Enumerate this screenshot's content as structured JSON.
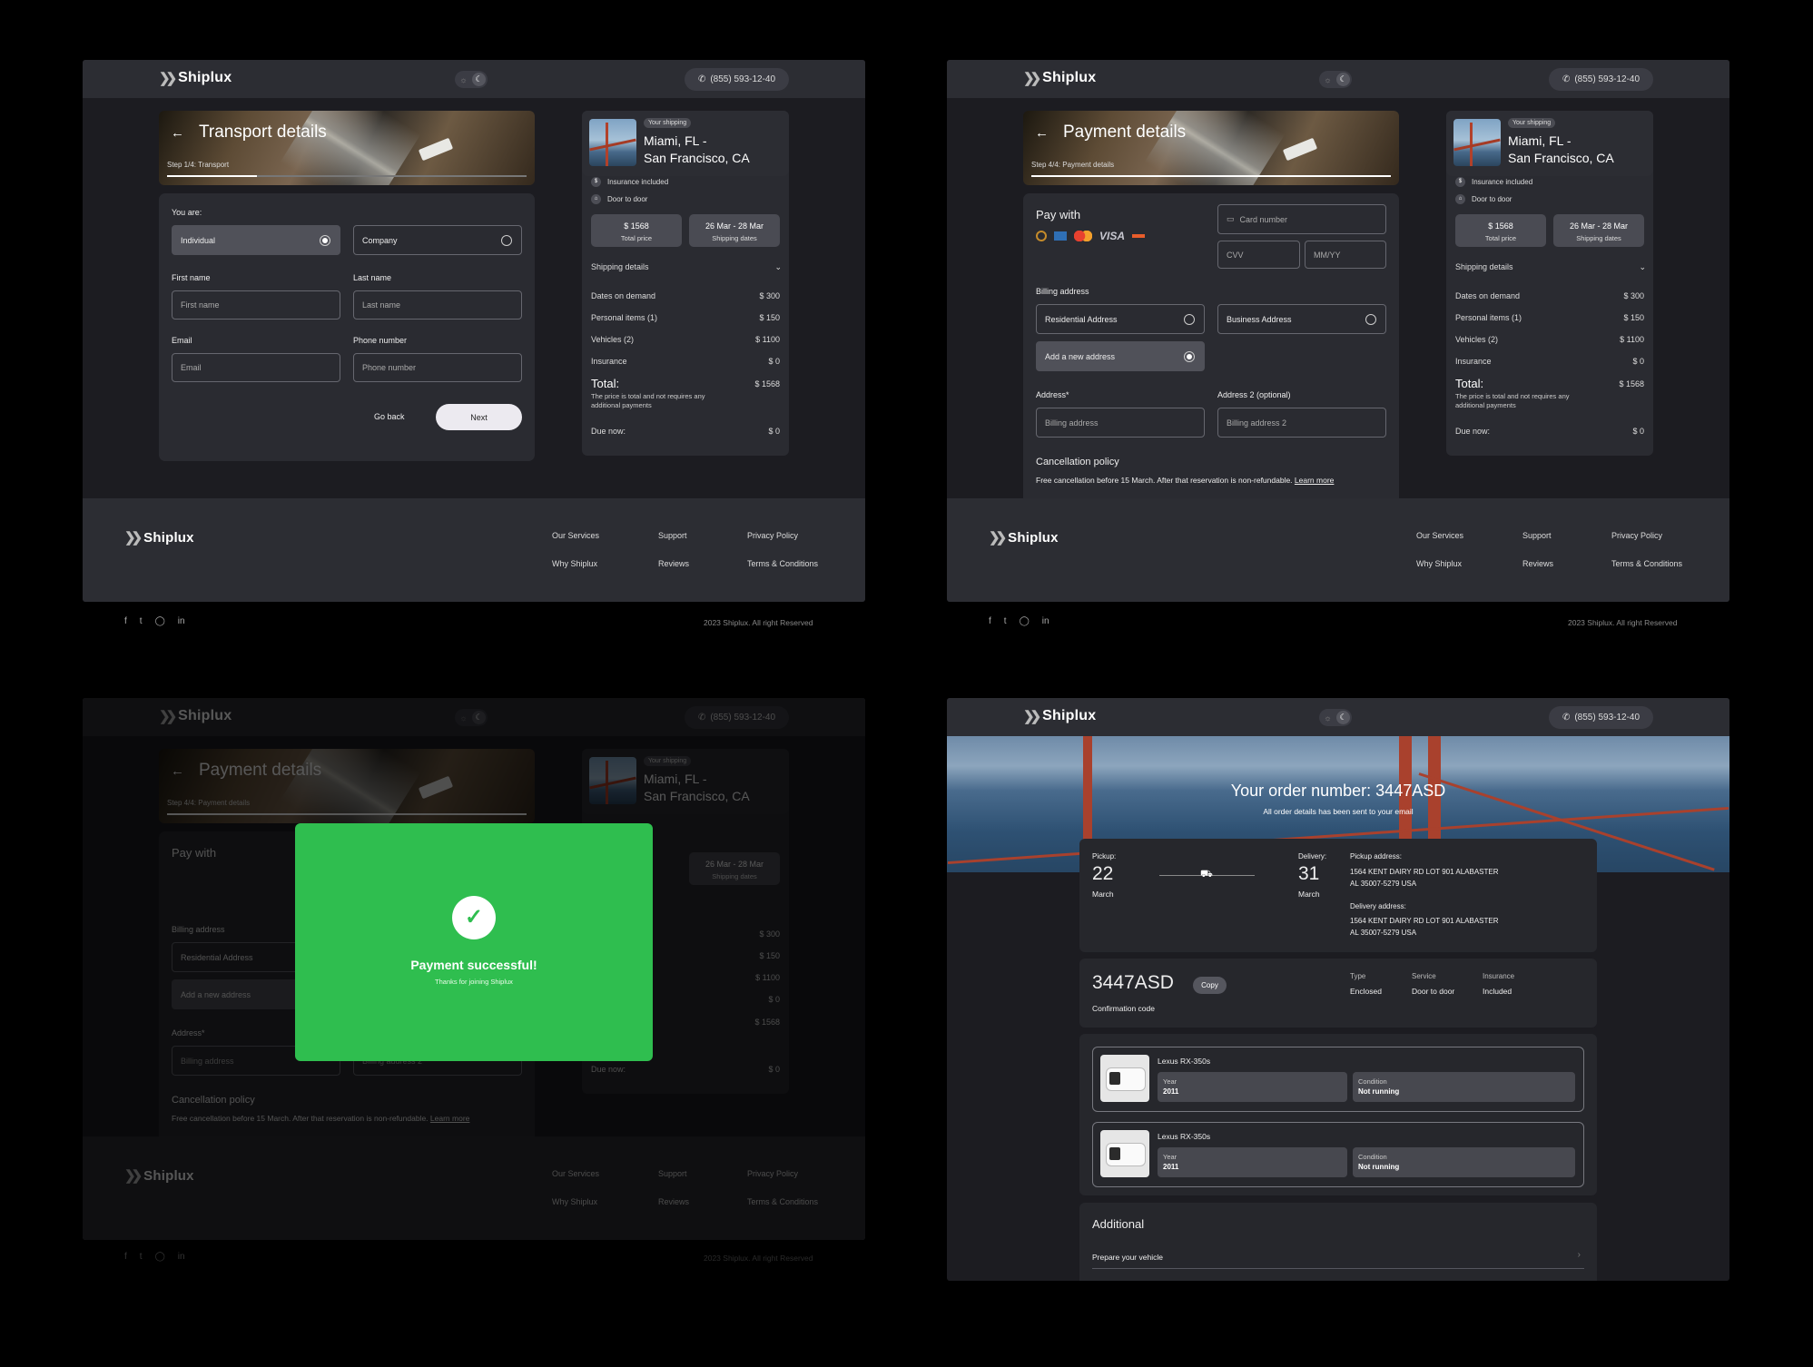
{
  "brand": "Shiplux",
  "phone": "(855) 593-12-40",
  "theme_toggle": {
    "light_icon": "sun-icon",
    "dark_icon": "moon-icon"
  },
  "transport": {
    "title": "Transport details",
    "step": "Step 1/4: Transport",
    "progress_fraction": 0.25,
    "you_are": "You are:",
    "individual": "Individual",
    "company": "Company",
    "first_name_label": "First name",
    "first_name_placeholder": "First name",
    "last_name_label": "Last name",
    "last_name_placeholder": "Last name",
    "email_label": "Email",
    "email_placeholder": "Email",
    "phone_label": "Phone number",
    "phone_placeholder": "Phone number",
    "go_back": "Go back",
    "next": "Next"
  },
  "payment": {
    "title": "Payment details",
    "step": "Step 4/4: Payment details",
    "progress_fraction": 1.0,
    "pay_with": "Pay with",
    "card_brands": [
      "bitcoin-icon",
      "amex-icon",
      "mastercard-icon",
      "VISA",
      "maestro-icon"
    ],
    "visa": "VISA",
    "card_number": "Card number",
    "cvv": "CVV",
    "expiry": "MM/YY",
    "billing_address": "Billing address",
    "residential": "Residential Address",
    "business": "Business Address",
    "add_new": "Add a new address",
    "address_label": "Address*",
    "address_placeholder": "Billing address",
    "address2_label": "Address 2 (optional)",
    "address2_placeholder": "Billing address 2",
    "cancel_title": "Cancellation policy",
    "cancel_text": "Free cancellation before 15 March. After that reservation is non-refundable.",
    "learn_more": "Learn more"
  },
  "summary": {
    "tag": "Your shipping",
    "route_line1": "Miami, FL -",
    "route_line2": "San Francisco, CA",
    "insurance_included": "Insurance included",
    "door_to_door": "Door to door",
    "total_price": "$ 1568",
    "total_price_label": "Total price",
    "dates": "26 Mar - 28 Mar",
    "dates_label": "Shipping dates",
    "shipping_details": "Shipping details",
    "rows": [
      {
        "label": "Dates on demand",
        "value": "$ 300"
      },
      {
        "label": "Personal items (1)",
        "value": "$ 150"
      },
      {
        "label": "Vehicles (2)",
        "value": "$ 1100"
      },
      {
        "label": "Insurance",
        "value": "$ 0"
      }
    ],
    "total_label": "Total:",
    "total_value": "$ 1568",
    "total_note": "The price is total and not requires any additional payments",
    "due_label": "Due now:",
    "due_value": "$ 0"
  },
  "footer": {
    "links": [
      "Our Services",
      "Support",
      "Privacy Policy",
      "Why Shiplux",
      "Reviews",
      "Terms & Conditions"
    ],
    "social": [
      "facebook-icon",
      "twitter-icon",
      "instagram-icon",
      "linkedin-icon"
    ],
    "copyright": "2023 Shiplux. All right Reserved"
  },
  "modal": {
    "title": "Payment successful!",
    "subtitle": "Thanks for joining Shiplux"
  },
  "order": {
    "heading": "Your order number: 3447ASD",
    "sub": "All order details has been sent to your email",
    "pickup_label": "Pickup:",
    "pickup_day": "22",
    "pickup_month": "March",
    "delivery_label": "Delivery:",
    "delivery_day": "31",
    "delivery_month": "March",
    "pickup_address_label": "Pickup address:",
    "pickup_address_1": "1564 KENT DAIRY RD LOT 901 ALABASTER",
    "pickup_address_2": "AL 35007-5279 USA",
    "delivery_address_label": "Delivery address:",
    "delivery_address_1": "1564 KENT DAIRY RD LOT 901 ALABASTER",
    "delivery_address_2": "AL 35007-5279 USA",
    "code": "3447ASD",
    "copy": "Copy",
    "code_label": "Confirmation code",
    "type_label": "Type",
    "type_value": "Enclosed",
    "service_label": "Service",
    "service_value": "Door to door",
    "insurance_label": "Insurance",
    "insurance_value": "Included",
    "vehicles": [
      {
        "name": "Lexus RX-350s",
        "year_label": "Year",
        "year": "2011",
        "cond_label": "Condition",
        "cond": "Not running"
      },
      {
        "name": "Lexus RX-350s",
        "year_label": "Year",
        "year": "2011",
        "cond_label": "Condition",
        "cond": "Not running"
      }
    ],
    "additional": "Additional",
    "prepare": "Prepare your vehicle"
  }
}
